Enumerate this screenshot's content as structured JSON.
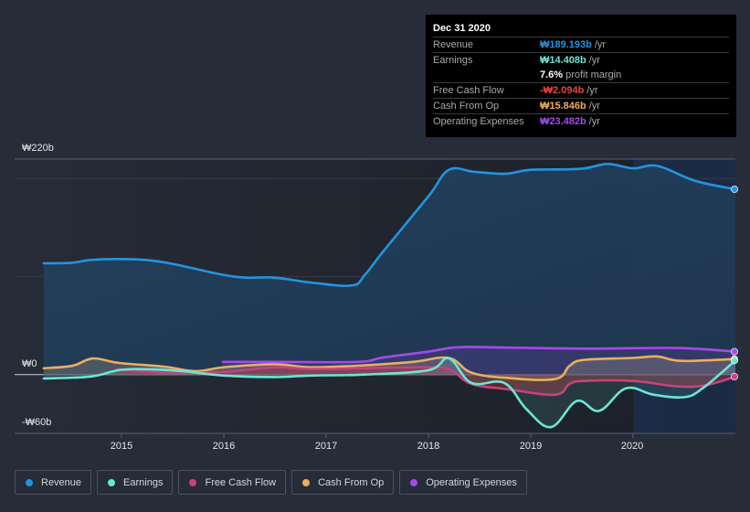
{
  "tooltip": {
    "date": "Dec 31 2020",
    "rows": [
      {
        "label": "Revenue",
        "value": "₩189.193b",
        "unit": "/yr",
        "color": "#2394df"
      },
      {
        "label": "Earnings",
        "value": "₩14.408b",
        "unit": "/yr",
        "color": "#6ce5d3"
      },
      {
        "label": "",
        "value": "7.6%",
        "unit": "profit margin",
        "color": "#ffffff"
      },
      {
        "label": "Free Cash Flow",
        "value": "-₩2.094b",
        "unit": "/yr",
        "color": "#e64545"
      },
      {
        "label": "Cash From Op",
        "value": "₩15.846b",
        "unit": "/yr",
        "color": "#eaae5f"
      },
      {
        "label": "Operating Expenses",
        "value": "₩23.482b",
        "unit": "/yr",
        "color": "#a34ce6"
      }
    ]
  },
  "legend": [
    {
      "label": "Revenue",
      "color": "#2394df"
    },
    {
      "label": "Earnings",
      "color": "#6ce5d3"
    },
    {
      "label": "Free Cash Flow",
      "color": "#c4437f"
    },
    {
      "label": "Cash From Op",
      "color": "#eaae5f"
    },
    {
      "label": "Operating Expenses",
      "color": "#a34ce6"
    }
  ],
  "chart_data": {
    "type": "line",
    "title": "",
    "xlabel": "",
    "ylabel": "",
    "currency": "KRW",
    "unit": "billion",
    "ylim": [
      -60,
      220
    ],
    "xlim": [
      2014.24,
      2021.0
    ],
    "y_tick_labels": [
      {
        "value": 220,
        "label": "₩220b"
      },
      {
        "value": 0,
        "label": "₩0"
      },
      {
        "value": -60,
        "label": "-₩60b"
      }
    ],
    "x_tick_labels": [
      {
        "value": 2015,
        "label": "2015"
      },
      {
        "value": 2016,
        "label": "2016"
      },
      {
        "value": 2017,
        "label": "2017"
      },
      {
        "value": 2018,
        "label": "2018"
      },
      {
        "value": 2019,
        "label": "2019"
      },
      {
        "value": 2020,
        "label": "2020"
      }
    ],
    "gridlines": [
      200,
      100,
      0
    ],
    "highlight_start": 2020.0,
    "legend_position": "bottom",
    "series": [
      {
        "name": "Revenue",
        "color": "#2394df",
        "fill": true,
        "points": [
          [
            2014.24,
            113.7
          ],
          [
            2014.5,
            114
          ],
          [
            2014.7,
            117
          ],
          [
            2014.97,
            118
          ],
          [
            2015.24,
            117
          ],
          [
            2015.5,
            113
          ],
          [
            2015.96,
            102.5
          ],
          [
            2016.22,
            99
          ],
          [
            2016.5,
            99
          ],
          [
            2016.85,
            94
          ],
          [
            2017.25,
            91
          ],
          [
            2017.38,
            102
          ],
          [
            2017.56,
            126
          ],
          [
            2018.0,
            182
          ],
          [
            2018.2,
            209
          ],
          [
            2018.45,
            207
          ],
          [
            2018.76,
            205
          ],
          [
            2018.99,
            209
          ],
          [
            2019.48,
            210
          ],
          [
            2019.75,
            215
          ],
          [
            2020.0,
            210.6
          ],
          [
            2020.24,
            213
          ],
          [
            2020.6,
            198
          ],
          [
            2021.0,
            189.193
          ]
        ]
      },
      {
        "name": "Operating Expenses",
        "color": "#a34ce6",
        "fill": true,
        "points": [
          [
            2015.99,
            13
          ],
          [
            2016.5,
            13
          ],
          [
            2017.3,
            13
          ],
          [
            2017.56,
            17.5
          ],
          [
            2018.0,
            23.5
          ],
          [
            2018.3,
            28
          ],
          [
            2018.8,
            27.5
          ],
          [
            2019.5,
            26.5
          ],
          [
            2020.0,
            27
          ],
          [
            2020.5,
            27
          ],
          [
            2021.0,
            23.482
          ]
        ]
      },
      {
        "name": "Cash From Op",
        "color": "#eaae5f",
        "fill": true,
        "points": [
          [
            2014.24,
            6.5
          ],
          [
            2014.52,
            9
          ],
          [
            2014.72,
            16.5
          ],
          [
            2014.97,
            12
          ],
          [
            2015.42,
            8
          ],
          [
            2015.73,
            3.5
          ],
          [
            2016.0,
            7.5
          ],
          [
            2016.5,
            10.5
          ],
          [
            2016.85,
            7.5
          ],
          [
            2017.38,
            9.5
          ],
          [
            2017.85,
            13
          ],
          [
            2018.2,
            17
          ],
          [
            2018.42,
            2
          ],
          [
            2018.78,
            -3.5
          ],
          [
            2019.24,
            -4.5
          ],
          [
            2019.38,
            9
          ],
          [
            2019.52,
            15
          ],
          [
            2020.0,
            17
          ],
          [
            2020.24,
            18.5
          ],
          [
            2020.47,
            14
          ],
          [
            2021.0,
            15.846
          ]
        ]
      },
      {
        "name": "Free Cash Flow",
        "color": "#c4437f",
        "fill": true,
        "points": [
          [
            2014.96,
            5.5
          ],
          [
            2015.42,
            2
          ],
          [
            2016.0,
            2.8
          ],
          [
            2016.5,
            7.5
          ],
          [
            2016.85,
            5.6
          ],
          [
            2017.38,
            6.5
          ],
          [
            2018.0,
            7.5
          ],
          [
            2018.22,
            4.5
          ],
          [
            2018.42,
            -9.5
          ],
          [
            2018.78,
            -15
          ],
          [
            2019.24,
            -20.5
          ],
          [
            2019.38,
            -9.5
          ],
          [
            2019.52,
            -6.5
          ],
          [
            2020.0,
            -6.5
          ],
          [
            2020.43,
            -12
          ],
          [
            2020.7,
            -11
          ],
          [
            2021.0,
            -2.094
          ]
        ]
      },
      {
        "name": "Earnings",
        "color": "#6ce5d3",
        "fill": true,
        "points": [
          [
            2014.24,
            -4
          ],
          [
            2014.7,
            -2
          ],
          [
            2014.97,
            4.5
          ],
          [
            2015.24,
            5.5
          ],
          [
            2015.6,
            3.5
          ],
          [
            2016.0,
            -1
          ],
          [
            2016.5,
            -2.5
          ],
          [
            2016.85,
            -1
          ],
          [
            2017.38,
            0
          ],
          [
            2018.0,
            4.5
          ],
          [
            2018.2,
            16.5
          ],
          [
            2018.42,
            -8.5
          ],
          [
            2018.74,
            -8.5
          ],
          [
            2018.96,
            -35.5
          ],
          [
            2019.2,
            -53.5
          ],
          [
            2019.45,
            -27
          ],
          [
            2019.67,
            -37
          ],
          [
            2019.93,
            -14
          ],
          [
            2020.2,
            -20.5
          ],
          [
            2020.5,
            -23
          ],
          [
            2020.68,
            -14
          ],
          [
            2021.0,
            14.408
          ]
        ]
      }
    ]
  }
}
